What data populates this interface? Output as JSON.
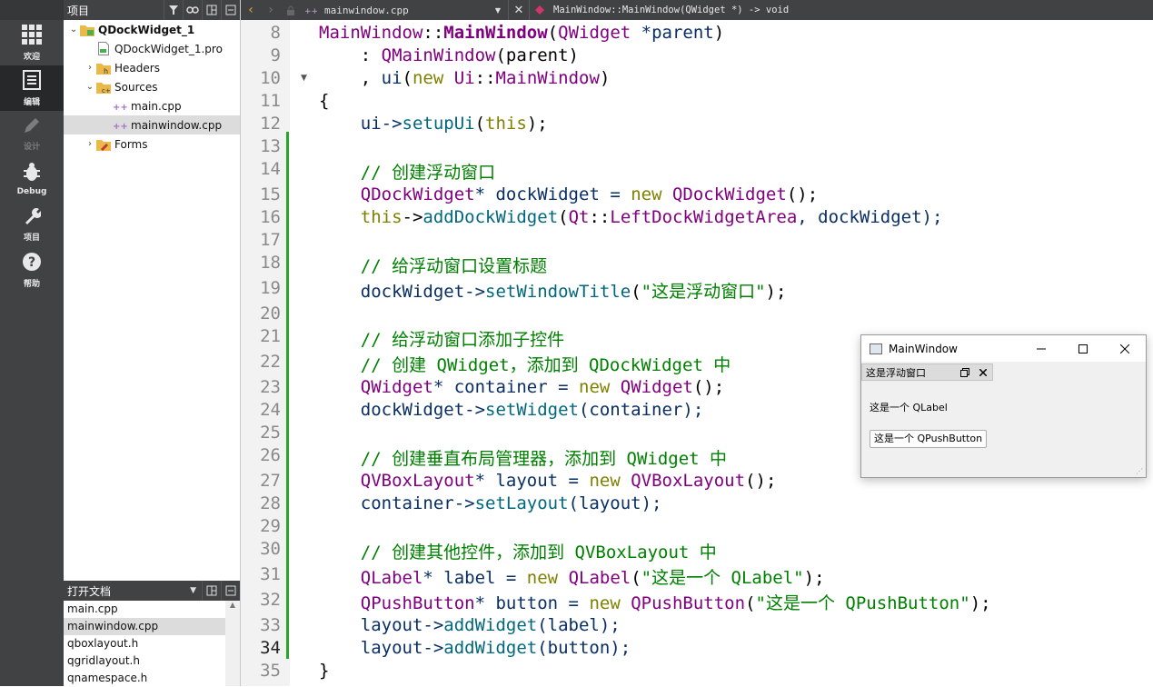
{
  "modes": [
    {
      "label": "欢迎",
      "icon": "grid-icon",
      "state": "normal"
    },
    {
      "label": "编辑",
      "icon": "edit-document-icon",
      "state": "active"
    },
    {
      "label": "设计",
      "icon": "pencil-icon",
      "state": "disabled"
    },
    {
      "label": "Debug",
      "icon": "bug-icon",
      "state": "normal"
    },
    {
      "label": "项目",
      "icon": "wrench-icon",
      "state": "normal"
    },
    {
      "label": "帮助",
      "icon": "help-icon",
      "state": "normal"
    }
  ],
  "project_panel": {
    "title": "项目",
    "tree": [
      {
        "label": "QDockWidget_1",
        "level": 0,
        "expanded": true,
        "icon": "project-folder-icon",
        "bold": true
      },
      {
        "label": "QDockWidget_1.pro",
        "level": 1,
        "icon": "pro-file-icon"
      },
      {
        "label": "Headers",
        "level": 1,
        "expanded": false,
        "icon": "headers-folder-icon"
      },
      {
        "label": "Sources",
        "level": 1,
        "expanded": true,
        "icon": "sources-folder-icon"
      },
      {
        "label": "main.cpp",
        "level": 2,
        "icon": "cpp-file-icon"
      },
      {
        "label": "mainwindow.cpp",
        "level": 2,
        "icon": "cpp-file-icon",
        "selected": true
      },
      {
        "label": "Forms",
        "level": 1,
        "expanded": false,
        "icon": "forms-folder-icon"
      }
    ]
  },
  "open_docs": {
    "title": "打开文档",
    "items": [
      {
        "label": "main.cpp"
      },
      {
        "label": "mainwindow.cpp",
        "selected": true
      },
      {
        "label": "qboxlayout.h"
      },
      {
        "label": "qgridlayout.h"
      },
      {
        "label": "qnamespace.h"
      }
    ]
  },
  "editor": {
    "file_name": "mainwindow.cpp",
    "function": "MainWindow::MainWindow(QWidget *) -> void",
    "current_line": "34",
    "lines": [
      {
        "n": "8",
        "tokens": [
          [
            "MainWindow",
            "ty"
          ],
          [
            "::",
            "p"
          ],
          [
            "MainWindow",
            "fnb"
          ],
          [
            "(",
            "p"
          ],
          [
            "QWidget",
            "ty"
          ],
          [
            " *parent",
            "v"
          ],
          [
            ")",
            "p"
          ]
        ]
      },
      {
        "n": "9",
        "tokens": [
          [
            "    : ",
            "p"
          ],
          [
            "QMainWindow",
            "ty"
          ],
          [
            "(parent)",
            "p"
          ]
        ]
      },
      {
        "n": "10",
        "tokens": [
          [
            "    , ",
            "p"
          ],
          [
            "ui",
            "v"
          ],
          [
            "(",
            "p"
          ],
          [
            "new",
            "kw"
          ],
          [
            " ",
            "p"
          ],
          [
            "Ui",
            "ty"
          ],
          [
            "::",
            "p"
          ],
          [
            "MainWindow",
            "ty"
          ],
          [
            ")",
            "p"
          ]
        ]
      },
      {
        "n": "11",
        "tokens": [
          [
            "{",
            "p"
          ]
        ]
      },
      {
        "n": "12",
        "tokens": [
          [
            "    ui->",
            "v"
          ],
          [
            "setupUi",
            "fn"
          ],
          [
            "(",
            "p"
          ],
          [
            "this",
            "kw"
          ],
          [
            ");",
            "p"
          ]
        ]
      },
      {
        "n": "13",
        "tokens": []
      },
      {
        "n": "14",
        "tokens": [
          [
            "    // 创建浮动窗口",
            "cm"
          ]
        ]
      },
      {
        "n": "15",
        "tokens": [
          [
            "    ",
            "p"
          ],
          [
            "QDockWidget",
            "ty"
          ],
          [
            "* dockWidget = ",
            "v"
          ],
          [
            "new",
            "kw"
          ],
          [
            " ",
            "p"
          ],
          [
            "QDockWidget",
            "ty"
          ],
          [
            "();",
            "p"
          ]
        ]
      },
      {
        "n": "16",
        "tokens": [
          [
            "    ",
            "p"
          ],
          [
            "this",
            "kw"
          ],
          [
            "->",
            "p"
          ],
          [
            "addDockWidget",
            "fn"
          ],
          [
            "(",
            "p"
          ],
          [
            "Qt",
            "ty"
          ],
          [
            "::",
            "p"
          ],
          [
            "LeftDockWidgetArea",
            "en"
          ],
          [
            ", dockWidget);",
            "v"
          ]
        ]
      },
      {
        "n": "17",
        "tokens": []
      },
      {
        "n": "18",
        "tokens": [
          [
            "    // 给浮动窗口设置标题",
            "cm"
          ]
        ]
      },
      {
        "n": "19",
        "tokens": [
          [
            "    dockWidget->",
            "v"
          ],
          [
            "setWindowTitle",
            "fn"
          ],
          [
            "(",
            "p"
          ],
          [
            "\"这是浮动窗口\"",
            "st"
          ],
          [
            ");",
            "p"
          ]
        ]
      },
      {
        "n": "20",
        "tokens": []
      },
      {
        "n": "21",
        "tokens": [
          [
            "    // 给浮动窗口添加子控件",
            "cm"
          ]
        ]
      },
      {
        "n": "22",
        "tokens": [
          [
            "    // 创建 QWidget，添加到 QDockWidget 中",
            "cm"
          ]
        ]
      },
      {
        "n": "23",
        "tokens": [
          [
            "    ",
            "p"
          ],
          [
            "QWidget",
            "ty"
          ],
          [
            "* container = ",
            "v"
          ],
          [
            "new",
            "kw"
          ],
          [
            " ",
            "p"
          ],
          [
            "QWidget",
            "ty"
          ],
          [
            "();",
            "p"
          ]
        ]
      },
      {
        "n": "24",
        "tokens": [
          [
            "    dockWidget->",
            "v"
          ],
          [
            "setWidget",
            "fn"
          ],
          [
            "(container);",
            "v"
          ]
        ]
      },
      {
        "n": "25",
        "tokens": []
      },
      {
        "n": "26",
        "tokens": [
          [
            "    // 创建垂直布局管理器，添加到 QWidget 中",
            "cm"
          ]
        ]
      },
      {
        "n": "27",
        "tokens": [
          [
            "    ",
            "p"
          ],
          [
            "QVBoxLayout",
            "ty"
          ],
          [
            "* layout = ",
            "v"
          ],
          [
            "new",
            "kw"
          ],
          [
            " ",
            "p"
          ],
          [
            "QVBoxLayout",
            "ty"
          ],
          [
            "();",
            "p"
          ]
        ]
      },
      {
        "n": "28",
        "tokens": [
          [
            "    container->",
            "v"
          ],
          [
            "setLayout",
            "fn"
          ],
          [
            "(layout);",
            "v"
          ]
        ]
      },
      {
        "n": "29",
        "tokens": []
      },
      {
        "n": "30",
        "tokens": [
          [
            "    // 创建其他控件，添加到 QVBoxLayout 中",
            "cm"
          ]
        ]
      },
      {
        "n": "31",
        "tokens": [
          [
            "    ",
            "p"
          ],
          [
            "QLabel",
            "ty"
          ],
          [
            "* label = ",
            "v"
          ],
          [
            "new",
            "kw"
          ],
          [
            " ",
            "p"
          ],
          [
            "QLabel",
            "ty"
          ],
          [
            "(",
            "p"
          ],
          [
            "\"这是一个 QLabel\"",
            "st"
          ],
          [
            ");",
            "p"
          ]
        ]
      },
      {
        "n": "32",
        "tokens": [
          [
            "    ",
            "p"
          ],
          [
            "QPushButton",
            "ty"
          ],
          [
            "* button = ",
            "v"
          ],
          [
            "new",
            "kw"
          ],
          [
            " ",
            "p"
          ],
          [
            "QPushButton",
            "ty"
          ],
          [
            "(",
            "p"
          ],
          [
            "\"这是一个 QPushButton\"",
            "st"
          ],
          [
            ");",
            "p"
          ]
        ]
      },
      {
        "n": "33",
        "tokens": [
          [
            "    layout->",
            "v"
          ],
          [
            "addWidget",
            "fn"
          ],
          [
            "(label);",
            "v"
          ]
        ]
      },
      {
        "n": "34",
        "tokens": [
          [
            "    layout->",
            "v"
          ],
          [
            "addWidget",
            "fn"
          ],
          [
            "(button);",
            "v"
          ]
        ]
      },
      {
        "n": "35",
        "tokens": [
          [
            "}",
            "p"
          ]
        ]
      }
    ]
  },
  "floating_window": {
    "title": "MainWindow",
    "dock_title": "这是浮动窗口",
    "label_text": "这是一个 QLabel",
    "button_text": "这是一个 QPushButton"
  },
  "colors": {
    "ty": "#800080",
    "fnb": "#800080",
    "fn": "#00677c",
    "kw": "#808000",
    "v": "#092e64",
    "p": "#000000",
    "cm": "#008000",
    "st": "#008000",
    "en": "#800080"
  }
}
